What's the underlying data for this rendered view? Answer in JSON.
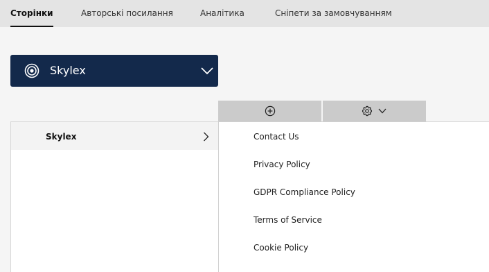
{
  "tabs": [
    {
      "label": "Сторінки",
      "active": true
    },
    {
      "label": "Авторські посилання",
      "active": false
    },
    {
      "label": "Аналітика",
      "active": false
    },
    {
      "label": "Сніпети за замовчуванням",
      "active": false
    }
  ],
  "site_selector": {
    "name": "Skylex",
    "icon": "radio-target-icon",
    "chevron": "chevron-down-icon",
    "background": "#13294b"
  },
  "tree": {
    "items": [
      {
        "label": "Skylex",
        "icon": "chevron-right-icon"
      }
    ]
  },
  "toolbar": {
    "add_icon": "plus-circle-icon",
    "settings_icon": "gear-icon",
    "settings_chevron": "chevron-down-icon"
  },
  "pages": [
    {
      "label": "Contact Us"
    },
    {
      "label": "Privacy Policy"
    },
    {
      "label": "GDPR Compliance Policy"
    },
    {
      "label": "Terms of Service"
    },
    {
      "label": "Cookie Policy"
    }
  ]
}
